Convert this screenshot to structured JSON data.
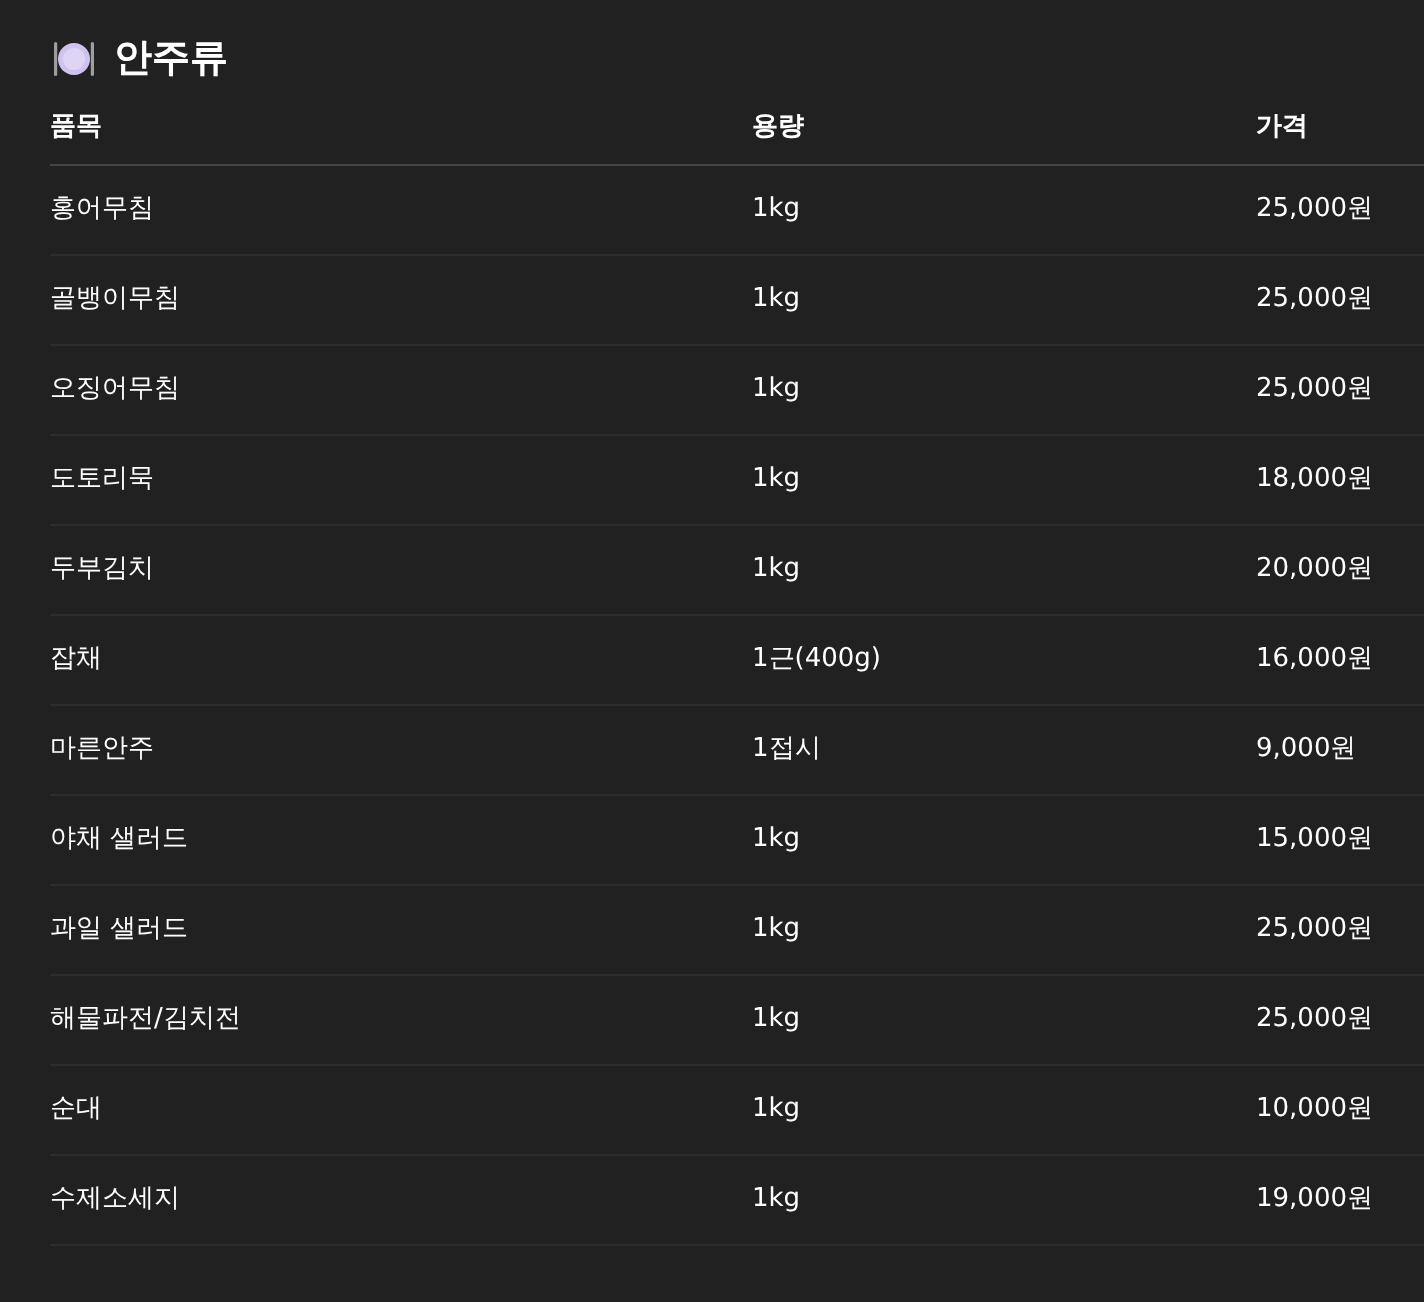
{
  "title": "안주류",
  "table": {
    "columns": [
      "품목",
      "용량",
      "가격"
    ],
    "rows": [
      [
        "홍어무침",
        "1kg",
        "25,000원"
      ],
      [
        "골뱅이무침",
        "1kg",
        "25,000원"
      ],
      [
        "오징어무침",
        "1kg",
        "25,000원"
      ],
      [
        "도토리묵",
        "1kg",
        "18,000원"
      ],
      [
        "두부김치",
        "1kg",
        "20,000원"
      ],
      [
        "잡채",
        "1근(400g)",
        "16,000원"
      ],
      [
        "마른안주",
        "1접시",
        "9,000원"
      ],
      [
        "야채 샐러드",
        "1kg",
        "15,000원"
      ],
      [
        "과일 샐러드",
        "1kg",
        "25,000원"
      ],
      [
        "해물파전/김치전",
        "1kg",
        "25,000원"
      ],
      [
        "순대",
        "1kg",
        "10,000원"
      ],
      [
        "수제소세지",
        "1kg",
        "19,000원"
      ]
    ]
  }
}
